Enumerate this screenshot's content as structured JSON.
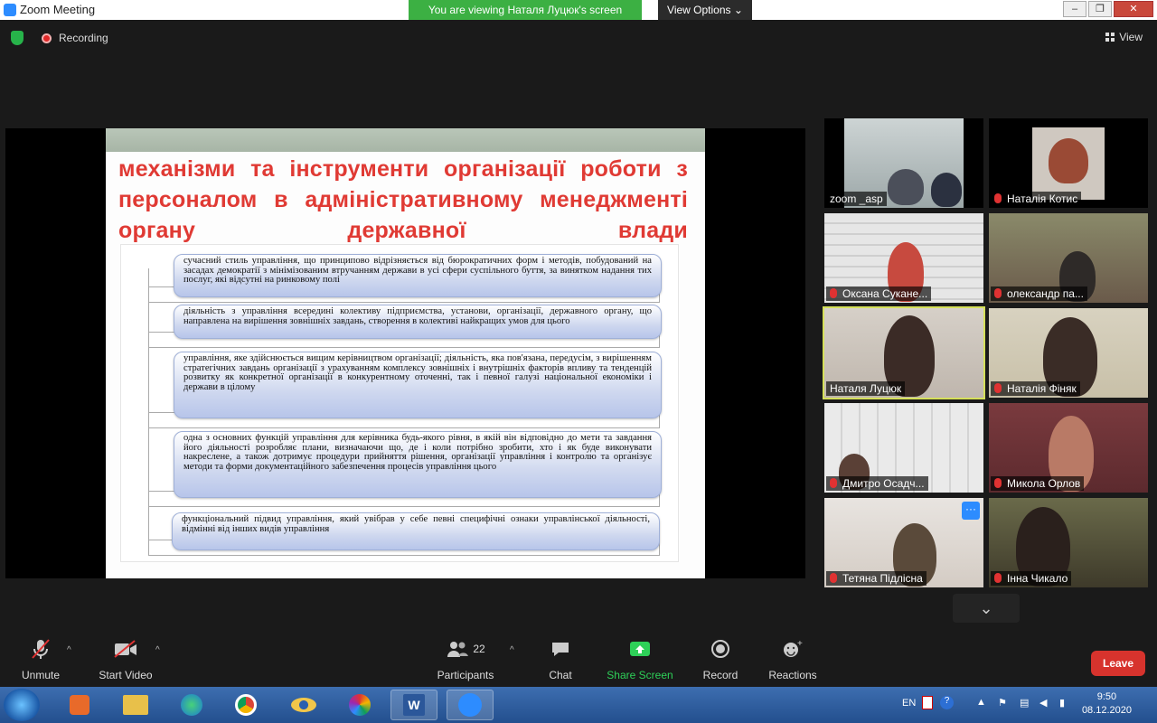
{
  "window": {
    "title": "Zoom Meeting",
    "banner": "You are viewing Наталя Луцюк's screen",
    "view_options": "View Options",
    "minimize": "–",
    "maximize": "❐",
    "close": "✕"
  },
  "topbar": {
    "recording": "Recording",
    "view": "View"
  },
  "slide": {
    "title": "механізми та інструменти організації роботи з персоналом в адміністративному менеджменті органу державної влади",
    "boxes": [
      "сучасний стиль управління, що принципово відрізняється від бюрократичних форм і методів, побудований на засадах демократії з мінімізованим втручанням держави в усі сфери суспільного буття, за винятком надання тих послуг, які відсутні на ринковому полі",
      "діяльність з управління всередині колективу підприємства, установи, організації, державного органу, що направлена на вирішення зовнішніх завдань, створення в колективі найкращих умов для цього",
      "управління, яке здійснюється вищим керівництвом організації; діяльність, яка пов'язана, передусім, з вирішенням стратегічних завдань організації з урахуванням комплексу зовнішніх і внутрішніх факторів впливу та тенденцій розвитку як конкретної організації в конкурентному оточенні, так і певної галузі національної економіки і держави в цілому",
      "одна з основних функцій управління для керівника будь-якого рівня, в якій він відповідно до мети та завдання його діяльності розробляє плани, визначаючи що, де і коли потрібно зробити, хто і як буде виконувати накреслене, а також дотримує процедури прийняття рішення, організації управління і контролю та організує методи та форми документаційного забезпечення процесів управління цього",
      "функціональний підвид управління, який увібрав у себе певні специфічні ознаки управлінської діяльності, відмінні від інших видів управління"
    ]
  },
  "participants": [
    {
      "name": "zoom _asp",
      "muted": false
    },
    {
      "name": "Наталія Котис",
      "muted": true
    },
    {
      "name": "Оксана Сукане...",
      "muted": true
    },
    {
      "name": "олександр па...",
      "muted": true
    },
    {
      "name": "Наталя Луцюк",
      "muted": false,
      "active": true
    },
    {
      "name": "Наталія Фіняк",
      "muted": true
    },
    {
      "name": "Дмитро Осадч...",
      "muted": true
    },
    {
      "name": "Микола Орлов",
      "muted": true
    },
    {
      "name": "Тетяна Підлісна",
      "muted": true
    },
    {
      "name": "Інна Чикало",
      "muted": true
    }
  ],
  "toolbar": {
    "unmute": "Unmute",
    "start_video": "Start Video",
    "participants": "Participants",
    "participants_count": "22",
    "chat": "Chat",
    "share_screen": "Share Screen",
    "record": "Record",
    "reactions": "Reactions",
    "leave": "Leave"
  },
  "taskbar": {
    "lang": "EN",
    "time": "9:50",
    "date": "08.12.2020"
  },
  "colors": {
    "accent": "#2d8cff",
    "banner": "#3cb043",
    "leave": "#d7332d",
    "title_red": "#e03a34"
  }
}
